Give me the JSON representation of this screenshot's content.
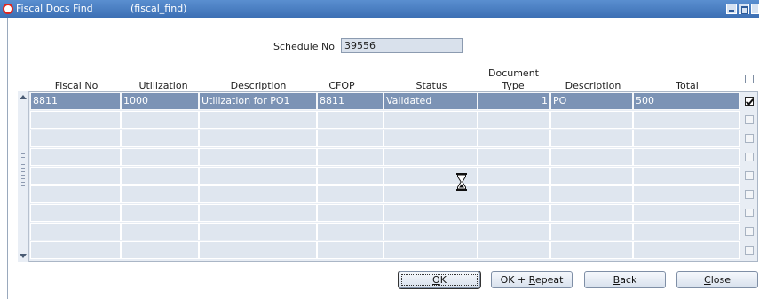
{
  "window": {
    "title": "Fiscal Docs Find",
    "module": "(fiscal_find)"
  },
  "schedule": {
    "label": "Schedule No",
    "value": "39556"
  },
  "columns": {
    "fiscal_no": "Fiscal No",
    "utilization": "Utilization",
    "description": "Description",
    "cfop": "CFOP",
    "status": "Status",
    "document_type_line1": "Document",
    "document_type_line2": "Type",
    "description2": "Description",
    "total": "Total"
  },
  "rows": [
    {
      "fiscal_no": "8811",
      "utilization": "1000",
      "description": "Utilization for PO1",
      "cfop": "8811",
      "status": "Validated",
      "document_type": "1",
      "description2": "PO",
      "total": "500",
      "checked": true
    }
  ],
  "buttons": {
    "ok": {
      "mnemonic": "O",
      "rest": "K"
    },
    "ok_repeat": {
      "prefix": "OK + ",
      "mnemonic": "R",
      "rest": "epeat"
    },
    "back": {
      "mnemonic": "B",
      "rest": "ack"
    },
    "close": {
      "mnemonic": "C",
      "rest": "lose"
    }
  },
  "icons": {
    "app": "oracle-ring-icon",
    "busy": "hourglass-icon"
  },
  "colors": {
    "titlebar": "#3c6fb4",
    "selected_row": "#7c93b5",
    "empty_cell": "#dfe6ef"
  }
}
